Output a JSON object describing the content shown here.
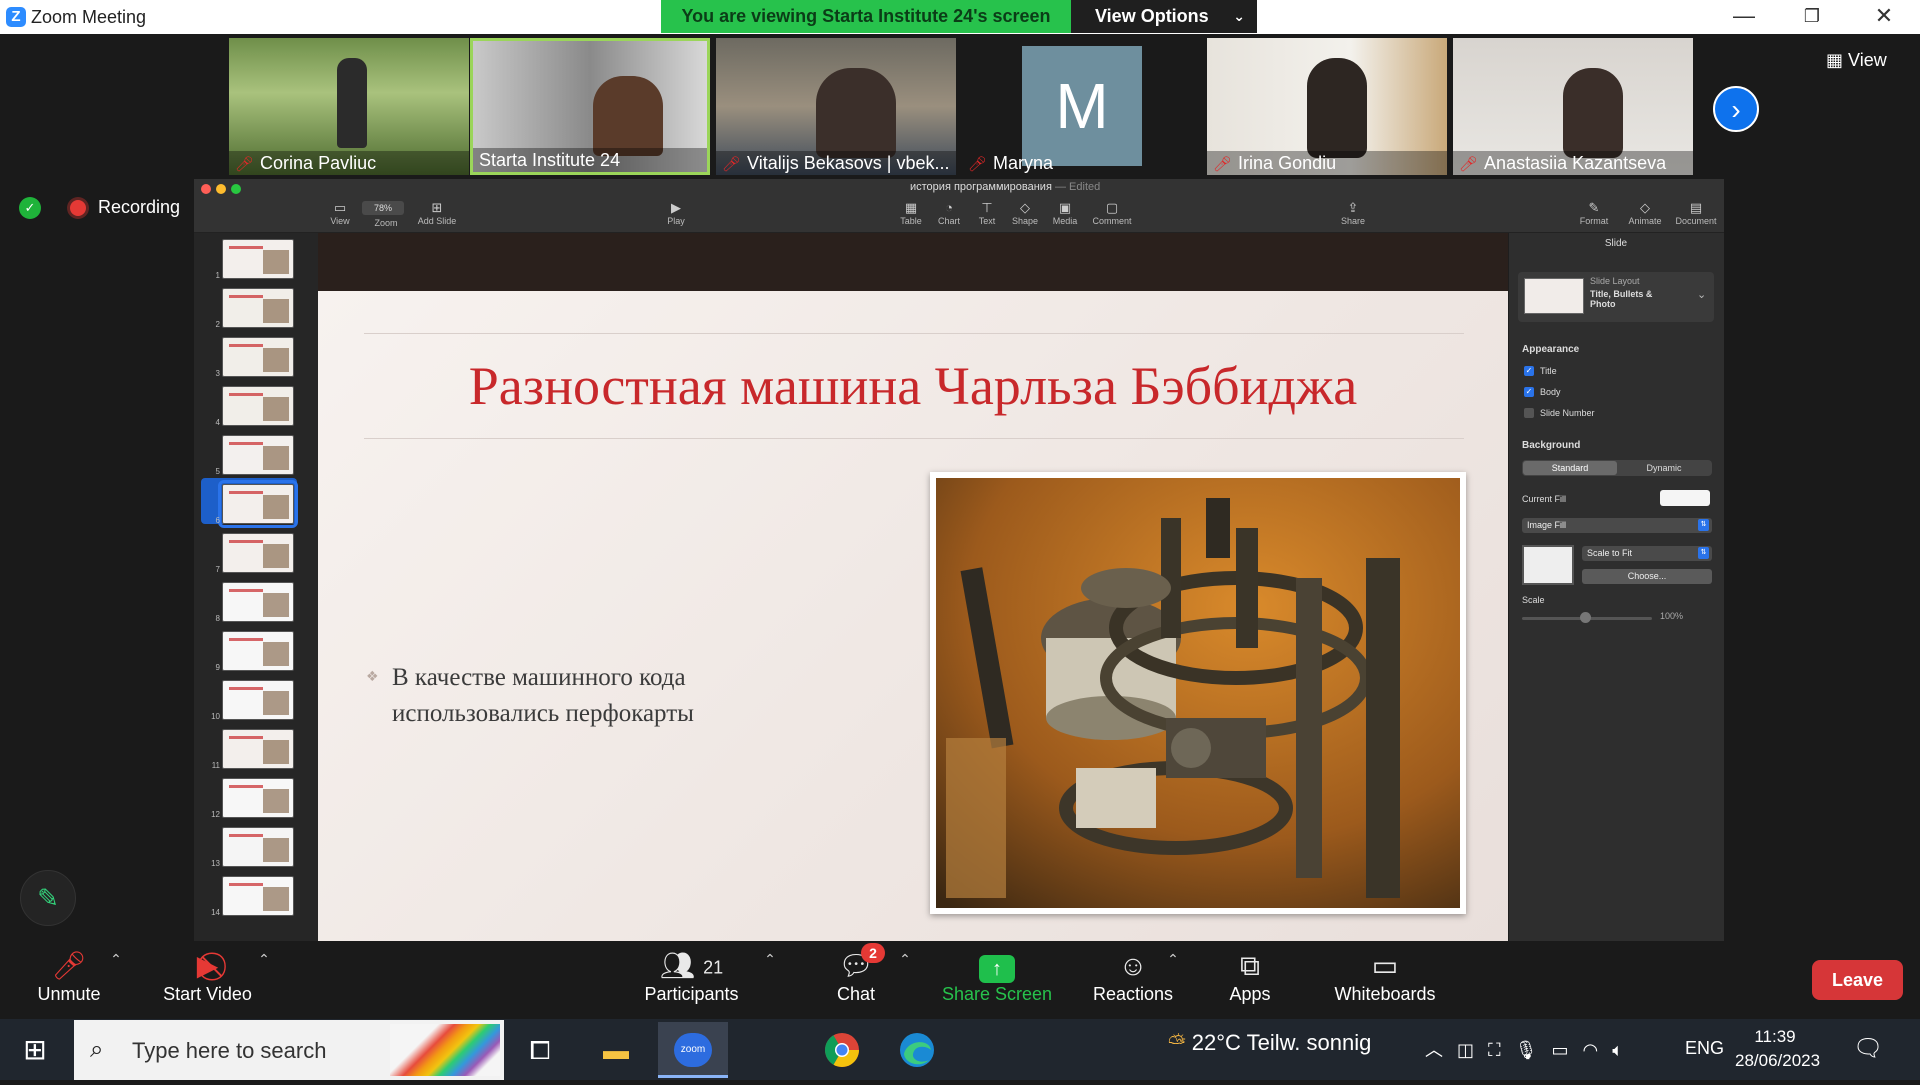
{
  "window": {
    "app_title": "Zoom Meeting",
    "share_banner": "You are viewing Starta Institute 24's screen",
    "view_options": "View Options",
    "view_label": "View"
  },
  "participants_strip": [
    {
      "name": "Corina Pavliuc",
      "muted": true
    },
    {
      "name": "Starta Institute 24",
      "muted": false,
      "active": true
    },
    {
      "name": "Vitalijs Bekasovs | vbek...",
      "muted": true
    },
    {
      "name": "Maryna",
      "muted": true,
      "avatar_letter": "M"
    },
    {
      "name": "Irina Gondiu",
      "muted": true
    },
    {
      "name": "Anastasiia Kazantseva",
      "muted": true
    }
  ],
  "status": {
    "recording_label": "Recording"
  },
  "keynote": {
    "doc_title": "история программирования",
    "doc_state": "— Edited",
    "zoom_value": "78%",
    "toolbar": [
      "View",
      "Zoom",
      "Add Slide",
      "Play",
      "Table",
      "Chart",
      "Text",
      "Shape",
      "Media",
      "Comment",
      "Share",
      "Format",
      "Animate",
      "Document"
    ],
    "slide_numbers": [
      "1",
      "2",
      "3",
      "4",
      "5",
      "6",
      "7",
      "8",
      "9",
      "10",
      "11",
      "12",
      "13",
      "14"
    ],
    "selected_slide": 6,
    "slide": {
      "title": "Разностная машина Чарльза Бэббиджа",
      "bullet": "В качестве машинного кода использовались перфокарты"
    },
    "inspector": {
      "tab": "Slide",
      "layout_caption": "Slide Layout",
      "layout_name": "Title, Bullets & Photo",
      "appearance_heading": "Appearance",
      "checkboxes": [
        {
          "label": "Title",
          "checked": true
        },
        {
          "label": "Body",
          "checked": true
        },
        {
          "label": "Slide Number",
          "checked": false
        }
      ],
      "background_heading": "Background",
      "segment_standard": "Standard",
      "segment_dynamic": "Dynamic",
      "current_fill_label": "Current Fill",
      "fill_type": "Image Fill",
      "scale_mode": "Scale to Fit",
      "choose_label": "Choose...",
      "scale_label": "Scale",
      "scale_value": "100%"
    }
  },
  "meeting_toolbar": {
    "unmute": "Unmute",
    "start_video": "Start Video",
    "participants": "Participants",
    "participants_count": "21",
    "chat": "Chat",
    "chat_badge": "2",
    "share_screen": "Share Screen",
    "reactions": "Reactions",
    "apps": "Apps",
    "whiteboards": "Whiteboards",
    "leave": "Leave"
  },
  "taskbar": {
    "search_placeholder": "Type here to search",
    "zoom_app_label": "zoom",
    "weather": "22°C  Teilw. sonnig",
    "language": "ENG",
    "time": "11:39",
    "date": "28/06/2023"
  },
  "colors": {
    "share_banner": "#27c24c",
    "slide_title": "#c8282b",
    "leave": "#d63638",
    "accent_blue": "#2a73ea"
  }
}
